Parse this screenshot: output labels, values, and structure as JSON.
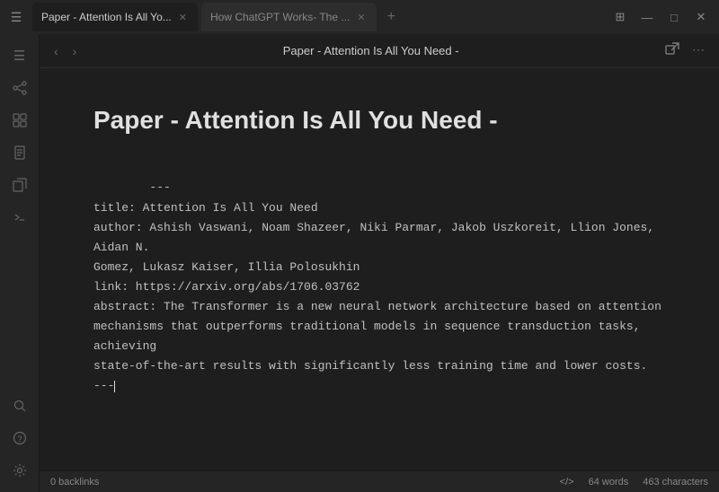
{
  "titleBar": {
    "windowIcon": "☰",
    "tabs": [
      {
        "id": "tab1",
        "label": "Paper - Attention Is All Yo...",
        "active": true,
        "closeable": true
      },
      {
        "id": "tab2",
        "label": "How ChatGPT Works- The ...",
        "active": false,
        "closeable": true
      }
    ],
    "addTabLabel": "+",
    "controls": {
      "layout": "⊞",
      "minimize": "—",
      "maximize": "□",
      "close": "✕"
    }
  },
  "sidebar": {
    "icons": [
      {
        "id": "menu",
        "symbol": "☰",
        "active": false
      },
      {
        "id": "graph",
        "symbol": "⌘",
        "active": false
      },
      {
        "id": "grid",
        "symbol": "⊞",
        "active": false
      },
      {
        "id": "file",
        "symbol": "📄",
        "active": false
      },
      {
        "id": "copy",
        "symbol": "⧉",
        "active": false
      },
      {
        "id": "terminal",
        "symbol": ">_",
        "active": false
      }
    ],
    "bottomIcons": [
      {
        "id": "search",
        "symbol": "⊙",
        "active": false
      },
      {
        "id": "help",
        "symbol": "?",
        "active": false
      },
      {
        "id": "settings",
        "symbol": "⚙",
        "active": false
      }
    ]
  },
  "navBar": {
    "backLabel": "‹",
    "forwardLabel": "›",
    "title": "Paper - Attention Is All You Need -",
    "openExternalIcon": "⧉",
    "moreIcon": "⋯"
  },
  "document": {
    "title": "Paper - Attention Is All You Need -",
    "body": "---\ntitle: Attention Is All You Need\nauthor: Ashish Vaswani, Noam Shazeer, Niki Parmar, Jakob Uszkoreit, Llion Jones, Aidan N.\nGomez, Lukasz Kaiser, Illia Polosukhin\nlink: https://arxiv.org/abs/1706.03762\nabstract: The Transformer is a new neural network architecture based on attention\nmechanisms that outperforms traditional models in sequence transduction tasks, achieving\nstate-of-the-art results with significantly less training time and lower costs.\n---"
  },
  "statusBar": {
    "backlinks": "0 backlinks",
    "codeIcon": "</>",
    "words": "64 words",
    "characters": "463 characters"
  }
}
